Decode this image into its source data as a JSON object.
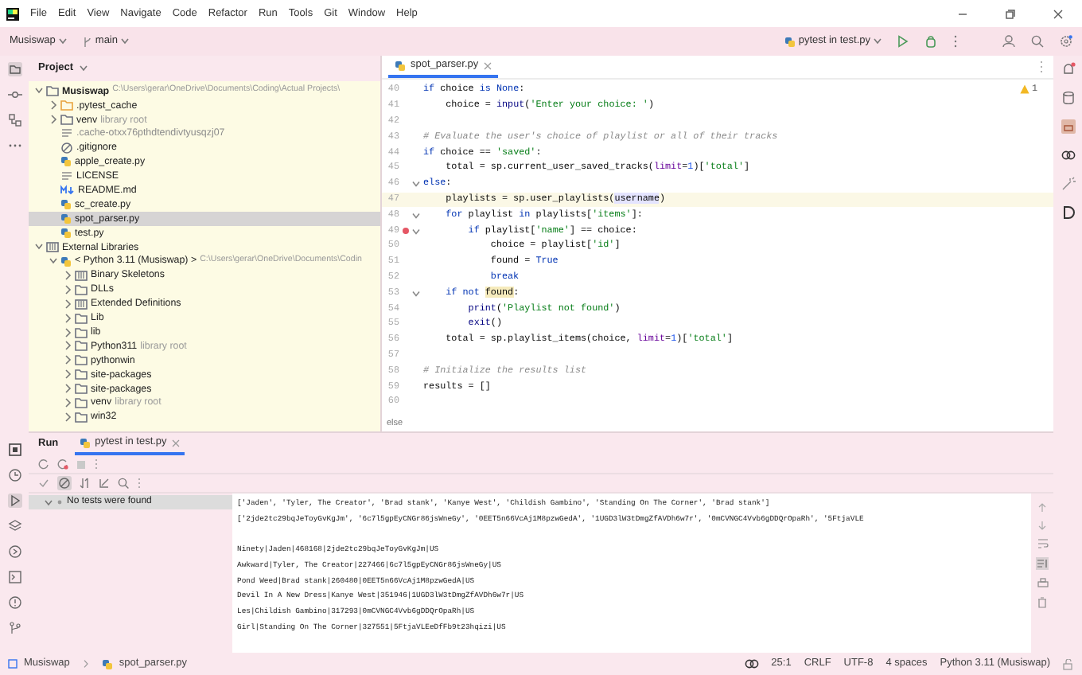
{
  "menu": [
    "File",
    "Edit",
    "View",
    "Navigate",
    "Code",
    "Refactor",
    "Run",
    "Tools",
    "Git",
    "Window",
    "Help"
  ],
  "toolbar": {
    "project": "Musiswap",
    "branch": "main",
    "run_config": "pytest in test.py"
  },
  "project_panel": {
    "title": "Project",
    "tree": [
      {
        "name": "Musiswap",
        "kind": "folder",
        "path": "C:\\Users\\gerar\\OneDrive\\Documents\\Coding\\Actual Projects\\",
        "expanded": true,
        "selected": false,
        "children": [
          {
            "name": ".pytest_cache",
            "kind": "excluded-folder",
            "expanded": false,
            "selected": false
          },
          {
            "name": "venv",
            "kind": "folder",
            "hint": "library root",
            "expanded": false,
            "selected": false
          },
          {
            "name": ".cache-otxx76pthdtendivtyusqzj07",
            "kind": "ignored-file",
            "selected": false
          },
          {
            "name": ".gitignore",
            "kind": "ignore",
            "selected": false
          },
          {
            "name": "apple_create.py",
            "kind": "python",
            "selected": false
          },
          {
            "name": "LICENSE",
            "kind": "file",
            "selected": false
          },
          {
            "name": "README.md",
            "kind": "markdown",
            "selected": false
          },
          {
            "name": "sc_create.py",
            "kind": "python",
            "selected": false
          },
          {
            "name": "spot_parser.py",
            "kind": "python",
            "selected": true
          },
          {
            "name": "test.py",
            "kind": "python",
            "selected": false
          }
        ]
      },
      {
        "name": "External Libraries",
        "kind": "libraries",
        "expanded": true,
        "selected": false,
        "children": [
          {
            "name": "< Python 3.11 (Musiswap) >",
            "kind": "python",
            "path": "C:\\Users\\gerar\\OneDrive\\Documents\\Codin",
            "expanded": true,
            "selected": false,
            "children": [
              {
                "name": "Binary Skeletons",
                "kind": "lib-folder",
                "expanded": false,
                "selected": false
              },
              {
                "name": "DLLs",
                "kind": "folder",
                "expanded": false,
                "selected": false
              },
              {
                "name": "Extended Definitions",
                "kind": "lib-folder",
                "expanded": false,
                "selected": false
              },
              {
                "name": "Lib",
                "kind": "folder",
                "expanded": false,
                "selected": false
              },
              {
                "name": "lib",
                "kind": "folder",
                "expanded": false,
                "selected": false
              },
              {
                "name": "Python311",
                "kind": "folder",
                "hint": "library root",
                "expanded": false,
                "selected": false
              },
              {
                "name": "pythonwin",
                "kind": "folder",
                "expanded": false,
                "selected": false
              },
              {
                "name": "site-packages",
                "kind": "folder",
                "expanded": false,
                "selected": false
              },
              {
                "name": "site-packages",
                "kind": "folder",
                "expanded": false,
                "selected": false
              },
              {
                "name": "venv",
                "kind": "folder",
                "hint": "library root",
                "expanded": false,
                "selected": false
              },
              {
                "name": "win32",
                "kind": "folder",
                "expanded": false,
                "selected": false
              }
            ]
          }
        ]
      }
    ]
  },
  "editor": {
    "tabs": [
      {
        "label": "spot_parser.py",
        "selected": true
      }
    ],
    "warnings": "1",
    "lines": [
      {
        "number": "40",
        "tokens": [
          {
            "kind": "keyword",
            "text": "if"
          },
          {
            "kind": "plain",
            "text": " choice "
          },
          {
            "kind": "keyword",
            "text": "is"
          },
          {
            "kind": "keyword",
            "text": " None"
          },
          {
            "kind": "plain",
            "text": ":"
          }
        ]
      },
      {
        "number": "41",
        "tokens": [
          {
            "kind": "plain",
            "text": "    choice = "
          },
          {
            "kind": "builtin",
            "text": "input"
          },
          {
            "kind": "plain",
            "text": "("
          },
          {
            "kind": "string",
            "text": "'Enter your choice: '"
          },
          {
            "kind": "plain",
            "text": ")"
          }
        ]
      },
      {
        "number": "42"
      },
      {
        "number": "43",
        "tokens": [
          {
            "kind": "comment",
            "text": "# Evaluate the user's choice of playlist or all of their tracks"
          }
        ]
      },
      {
        "number": "44",
        "tokens": [
          {
            "kind": "keyword",
            "text": "if"
          },
          {
            "kind": "plain",
            "text": " choice == "
          },
          {
            "kind": "string",
            "text": "'saved'"
          },
          {
            "kind": "plain",
            "text": ":"
          }
        ]
      },
      {
        "number": "45",
        "tokens": [
          {
            "kind": "plain",
            "text": "    total = sp.current_user_saved_tracks("
          },
          {
            "kind": "argument",
            "text": "limit"
          },
          {
            "kind": "plain",
            "text": "="
          },
          {
            "kind": "number",
            "text": "1"
          },
          {
            "kind": "plain",
            "text": ")["
          },
          {
            "kind": "string",
            "text": "'total'"
          },
          {
            "kind": "plain",
            "text": "]"
          }
        ]
      },
      {
        "number": "46",
        "fold": true,
        "tokens": [
          {
            "kind": "keyword",
            "text": "else"
          },
          {
            "kind": "plain",
            "text": ":"
          }
        ]
      },
      {
        "number": "47",
        "current": true,
        "tokens": [
          {
            "kind": "plain",
            "text": "    playlists = sp.user_playlists("
          },
          {
            "kind": "usage",
            "text": "username"
          },
          {
            "kind": "plain",
            "text": ")"
          }
        ]
      },
      {
        "number": "48",
        "fold": true,
        "tokens": [
          {
            "kind": "keyword",
            "text": "    for"
          },
          {
            "kind": "plain",
            "text": " playlist "
          },
          {
            "kind": "keyword",
            "text": "in"
          },
          {
            "kind": "plain",
            "text": " playlists["
          },
          {
            "kind": "string",
            "text": "'items'"
          },
          {
            "kind": "plain",
            "text": "]:"
          }
        ]
      },
      {
        "number": "49",
        "fold": true,
        "breakpoint": true,
        "tokens": [
          {
            "kind": "keyword",
            "text": "        if"
          },
          {
            "kind": "plain",
            "text": " playlist["
          },
          {
            "kind": "string",
            "text": "'name'"
          },
          {
            "kind": "plain",
            "text": "] == choice:"
          }
        ]
      },
      {
        "number": "50",
        "tokens": [
          {
            "kind": "plain",
            "text": "            choice = playlist["
          },
          {
            "kind": "string",
            "text": "'id'"
          },
          {
            "kind": "plain",
            "text": "]"
          }
        ]
      },
      {
        "number": "51",
        "tokens": [
          {
            "kind": "plain",
            "text": "            found = "
          },
          {
            "kind": "keyword",
            "text": "True"
          }
        ]
      },
      {
        "number": "52",
        "tokens": [
          {
            "kind": "keyword",
            "text": "            break"
          }
        ]
      },
      {
        "number": "53",
        "fold": true,
        "tokens": [
          {
            "kind": "keyword",
            "text": "    if not "
          },
          {
            "kind": "warning",
            "text": "found"
          },
          {
            "kind": "plain",
            "text": ":"
          }
        ]
      },
      {
        "number": "54",
        "tokens": [
          {
            "kind": "builtin",
            "text": "        print"
          },
          {
            "kind": "plain",
            "text": "("
          },
          {
            "kind": "string",
            "text": "'Playlist not found'"
          },
          {
            "kind": "plain",
            "text": ")"
          }
        ]
      },
      {
        "number": "55",
        "tokens": [
          {
            "kind": "builtin",
            "text": "        exit"
          },
          {
            "kind": "plain",
            "text": "()"
          }
        ]
      },
      {
        "number": "56",
        "tokens": [
          {
            "kind": "plain",
            "text": "    total = sp.playlist_items(choice, "
          },
          {
            "kind": "argument",
            "text": "limit"
          },
          {
            "kind": "plain",
            "text": "="
          },
          {
            "kind": "number",
            "text": "1"
          },
          {
            "kind": "plain",
            "text": ")["
          },
          {
            "kind": "string",
            "text": "'total'"
          },
          {
            "kind": "plain",
            "text": "]"
          }
        ]
      },
      {
        "number": "57"
      },
      {
        "number": "58",
        "tokens": [
          {
            "kind": "comment",
            "text": "# Initialize the results list"
          }
        ]
      },
      {
        "number": "59",
        "tokens": [
          {
            "kind": "plain",
            "text": "results = []"
          }
        ]
      },
      {
        "number": "60"
      }
    ],
    "breadcrumb": "else"
  },
  "run_panel": {
    "title": "Run",
    "tabs": [
      {
        "label": "pytest in test.py",
        "selected": true
      }
    ],
    "test_tree": [
      {
        "label": "No tests were found",
        "selected": true
      }
    ],
    "console": [
      [
        "['Jaden', 'Tyler, The Creator', 'Brad stank', 'Kanye West', 'Childish Gambino', 'Standing On The Corner', 'Brad stank']",
        "['2jde2tc29bqJeToyGvKgJm', '6c7l5gpEyCNGr86jsWneGy', '0EET5n66VcAj1M8pzwGedA', '1UGD3lW3tDmgZfAVDh6w7r', '0mCVNGC4Vvb6gDDQrOpaRh', '5FtjaVLE"
      ],
      [
        "Ninety|Jaden|468168|2jde2tc29bqJeToyGvKgJm|US",
        "Awkward|Tyler, The Creator|227466|6c7l5gpEyCNGr86jsWneGy|US",
        "Pond Weed|Brad stank|260480|0EET5n66VcAj1M8pzwGedA|US",
        "Devil In A New Dress|Kanye West|351946|1UGD3lW3tDmgZfAVDh6w7r|US",
        "Les|Childish Gambino|317293|0mCVNGC4Vvb6gDDQrOpaRh|US",
        "Girl|Standing On The Corner|327551|5FtjaVLEeDfFb9t23hqizi|US"
      ]
    ]
  },
  "status_bar": {
    "breadcrumb": [
      "Musiswap",
      "spot_parser.py"
    ],
    "items": [
      "25:1",
      "CRLF",
      "UTF-8",
      "4 spaces",
      "Python 3.11 (Musiswap)"
    ]
  }
}
